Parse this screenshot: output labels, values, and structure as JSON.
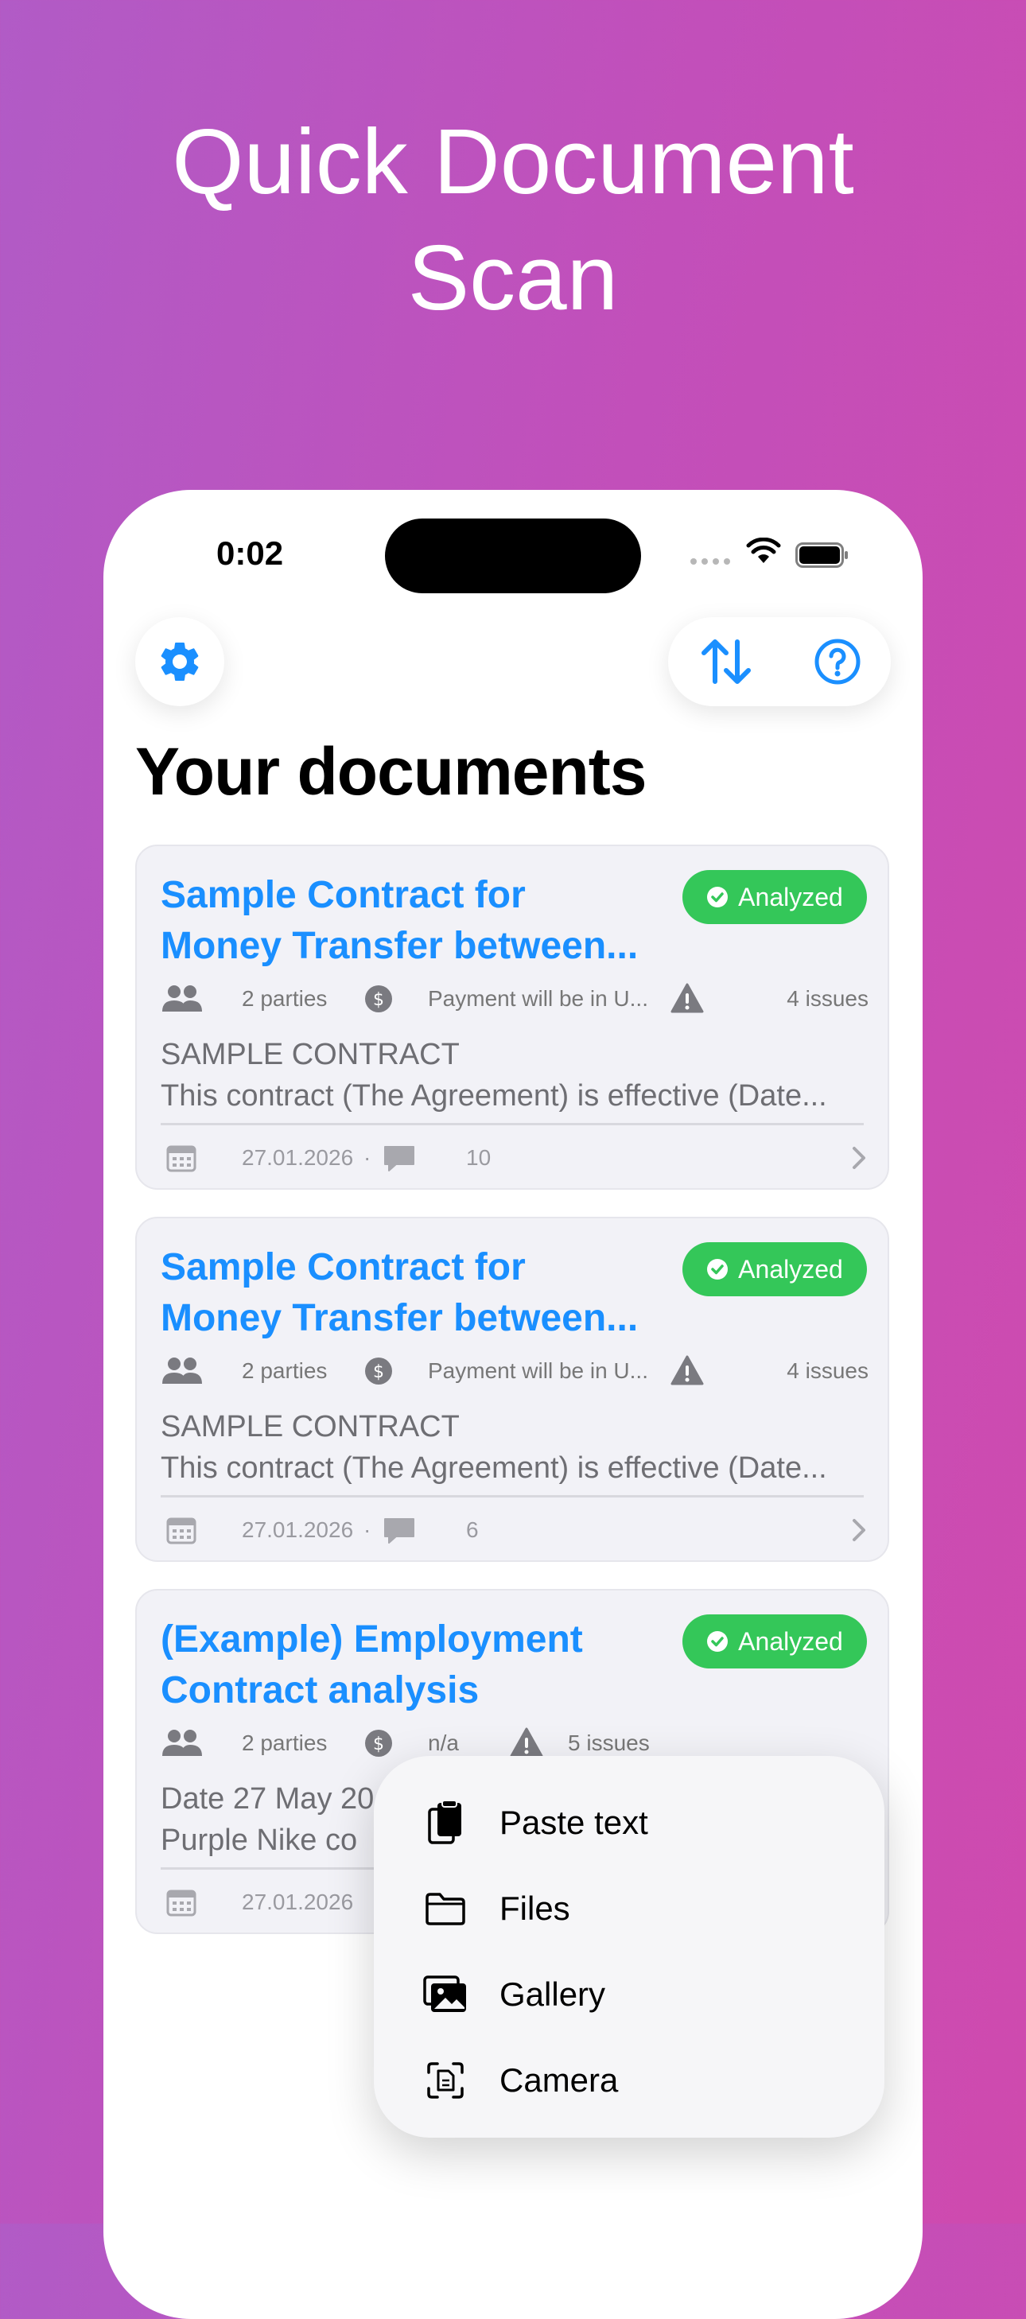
{
  "promo": {
    "line1": "Quick Document",
    "line2": "Scan"
  },
  "status_bar": {
    "time": "0:02"
  },
  "toolbar": {
    "settings_icon": "gear-icon",
    "sort_icon": "sort-arrows-icon",
    "help_icon": "question-icon"
  },
  "page": {
    "title": "Your documents"
  },
  "colors": {
    "accent": "#1a8fff",
    "analyzed": "#34c759"
  },
  "documents": [
    {
      "title_line1": "Sample Contract for",
      "title_line2": "Money Transfer between...",
      "status": "Analyzed",
      "parties": "2 parties",
      "payment": "Payment will be in U...",
      "issues": "4 issues",
      "excerpt_line1": "SAMPLE CONTRACT",
      "excerpt_line2": "This contract (The Agreement) is effective (Date...",
      "date": "27.01.2026",
      "separator": "·",
      "comments": "10"
    },
    {
      "title_line1": "Sample Contract for",
      "title_line2": "Money Transfer between...",
      "status": "Analyzed",
      "parties": "2 parties",
      "payment": "Payment will be in U...",
      "issues": "4 issues",
      "excerpt_line1": "SAMPLE CONTRACT",
      "excerpt_line2": "This contract (The Agreement) is effective (Date...",
      "date": "27.01.2026",
      "separator": "·",
      "comments": "6"
    },
    {
      "title_line1": "(Example) Employment",
      "title_line2": "Contract analysis",
      "status": "Analyzed",
      "parties": "2 parties",
      "payment": "n/a",
      "issues": "5 issues",
      "excerpt_line1": "Date 27 May 20",
      "excerpt_line2": "Purple Nike co",
      "date": "27.01.2026"
    }
  ],
  "import_menu": [
    {
      "label": "Paste text",
      "icon": "paste-icon"
    },
    {
      "label": "Files",
      "icon": "folder-icon"
    },
    {
      "label": "Gallery",
      "icon": "gallery-icon"
    },
    {
      "label": "Camera",
      "icon": "document-scan-icon"
    }
  ]
}
